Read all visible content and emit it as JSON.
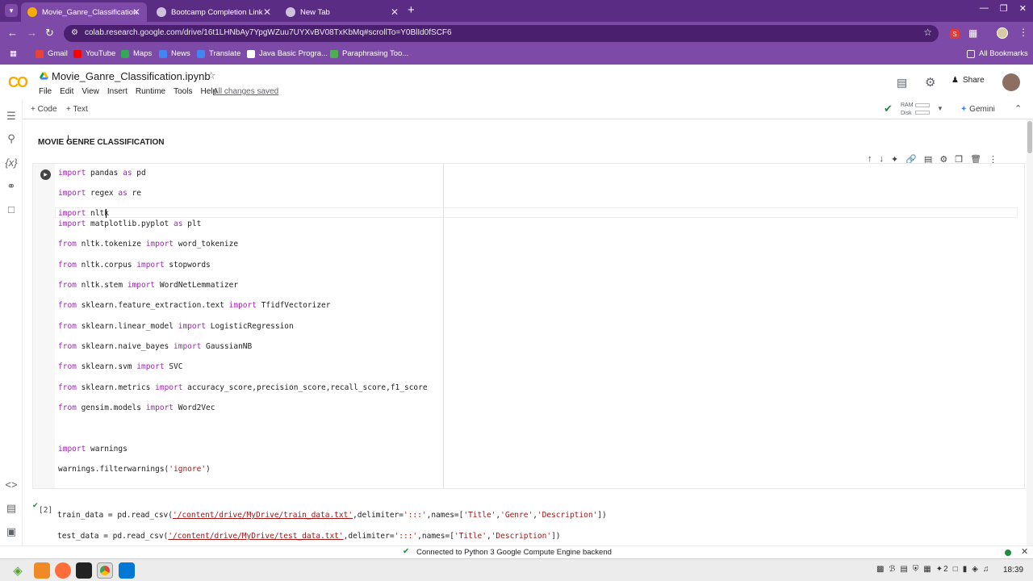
{
  "browser": {
    "tabs": [
      {
        "title": "Movie_Ganre_Classification"
      },
      {
        "title": "Bootcamp Completion Link"
      },
      {
        "title": "New Tab"
      }
    ],
    "url": "colab.research.google.com/drive/16t1LHNbAy7YpgWZuu7UYXvBV08TxKbMq#scrollTo=Y0BlId0fSCF6",
    "bookmarks": [
      "Gmail",
      "YouTube",
      "Maps",
      "News",
      "Translate",
      "Java Basic Progra...",
      "Paraphrasing Too..."
    ],
    "all_bookmarks": "All Bookmarks",
    "ext_badge": "S",
    "colors": {
      "frame": "#5b2c83",
      "toolbar": "#7d4aa8",
      "omnibox": "#4a1f6e"
    }
  },
  "colab": {
    "logo": "CO",
    "title": "Movie_Ganre_Classification.ipynb",
    "menu": [
      "File",
      "Edit",
      "View",
      "Insert",
      "Runtime",
      "Tools",
      "Help"
    ],
    "saved_status": "All changes saved",
    "share_label": "Share",
    "add_code": "+ Code",
    "add_text": "+ Text",
    "ram_label": "RAM",
    "disk_label": "Disk",
    "gemini_label": "Gemini"
  },
  "notebook": {
    "heading": "MOVIE GENRE CLASSIFICATION",
    "cell1_lines": [
      [
        {
          "t": "import",
          "k": "kw"
        },
        {
          "t": " pandas "
        },
        {
          "t": "as",
          "k": "kw"
        },
        {
          "t": " pd"
        }
      ],
      [
        {
          "t": "import",
          "k": "kw"
        },
        {
          "t": " regex "
        },
        {
          "t": "as",
          "k": "kw"
        },
        {
          "t": " re"
        }
      ],
      [
        {
          "t": "import",
          "k": "kw"
        },
        {
          "t": " nltk"
        }
      ],
      [
        {
          "t": "import",
          "k": "kw"
        },
        {
          "t": " matplotlib.pyplot "
        },
        {
          "t": "as",
          "k": "kw"
        },
        {
          "t": " plt"
        }
      ],
      [
        {
          "t": "from",
          "k": "kw"
        },
        {
          "t": " nltk.tokenize "
        },
        {
          "t": "import",
          "k": "kw"
        },
        {
          "t": " word_tokenize"
        }
      ],
      [
        {
          "t": "from",
          "k": "kw"
        },
        {
          "t": " nltk.corpus "
        },
        {
          "t": "import",
          "k": "kw"
        },
        {
          "t": " stopwords"
        }
      ],
      [
        {
          "t": "from",
          "k": "kw"
        },
        {
          "t": " nltk.stem "
        },
        {
          "t": "import",
          "k": "kw"
        },
        {
          "t": " WordNetLemmatizer"
        }
      ],
      [
        {
          "t": "from",
          "k": "kw"
        },
        {
          "t": " sklearn.feature_extraction.text "
        },
        {
          "t": "import",
          "k": "kw"
        },
        {
          "t": " TfidfVectorizer"
        }
      ],
      [
        {
          "t": "from",
          "k": "kw"
        },
        {
          "t": " sklearn.linear_model "
        },
        {
          "t": "import",
          "k": "kw"
        },
        {
          "t": " LogisticRegression"
        }
      ],
      [
        {
          "t": "from",
          "k": "kw"
        },
        {
          "t": " sklearn.naive_bayes "
        },
        {
          "t": "import",
          "k": "kw"
        },
        {
          "t": " GaussianNB"
        }
      ],
      [
        {
          "t": "from",
          "k": "kw"
        },
        {
          "t": " sklearn.svm "
        },
        {
          "t": "import",
          "k": "kw"
        },
        {
          "t": " SVC"
        }
      ],
      [
        {
          "t": "from",
          "k": "kw"
        },
        {
          "t": " sklearn.metrics "
        },
        {
          "t": "import",
          "k": "kw"
        },
        {
          "t": " accuracy_score,precision_score,recall_score,f1_score"
        }
      ],
      [
        {
          "t": "from",
          "k": "kw"
        },
        {
          "t": " gensim.models "
        },
        {
          "t": "import",
          "k": "kw"
        },
        {
          "t": " Word2Vec"
        }
      ],
      [
        {
          "t": "import",
          "k": "kw"
        },
        {
          "t": " warnings"
        }
      ],
      [
        {
          "t": "warnings.filterwarnings("
        },
        {
          "t": "'ignore'",
          "k": "str"
        },
        {
          "t": ")"
        }
      ]
    ],
    "cell2_exec_count": "[2]",
    "cell2_lines": [
      [
        {
          "t": "train_data = pd.read_csv("
        },
        {
          "t": "'/content/drive/MyDrive/train_data.txt'",
          "k": "strlink"
        },
        {
          "t": ",delimiter="
        },
        {
          "t": "':::'",
          "k": "str"
        },
        {
          "t": ",names=["
        },
        {
          "t": "'Title'",
          "k": "str"
        },
        {
          "t": ","
        },
        {
          "t": "'Genre'",
          "k": "str"
        },
        {
          "t": ","
        },
        {
          "t": "'Description'",
          "k": "str"
        },
        {
          "t": "])"
        }
      ],
      [
        {
          "t": "test_data = pd.read_csv("
        },
        {
          "t": "'/content/drive/MyDrive/test_data.txt'",
          "k": "strlink"
        },
        {
          "t": ",delimiter="
        },
        {
          "t": "':::'",
          "k": "str"
        },
        {
          "t": ",names=["
        },
        {
          "t": "'Title'",
          "k": "str"
        },
        {
          "t": ","
        },
        {
          "t": "'Description'",
          "k": "str"
        },
        {
          "t": "])"
        }
      ]
    ]
  },
  "status": {
    "text": "Connected to Python 3 Google Compute Engine backend"
  },
  "taskbar": {
    "clock": "18:39",
    "tray_count": "2"
  }
}
